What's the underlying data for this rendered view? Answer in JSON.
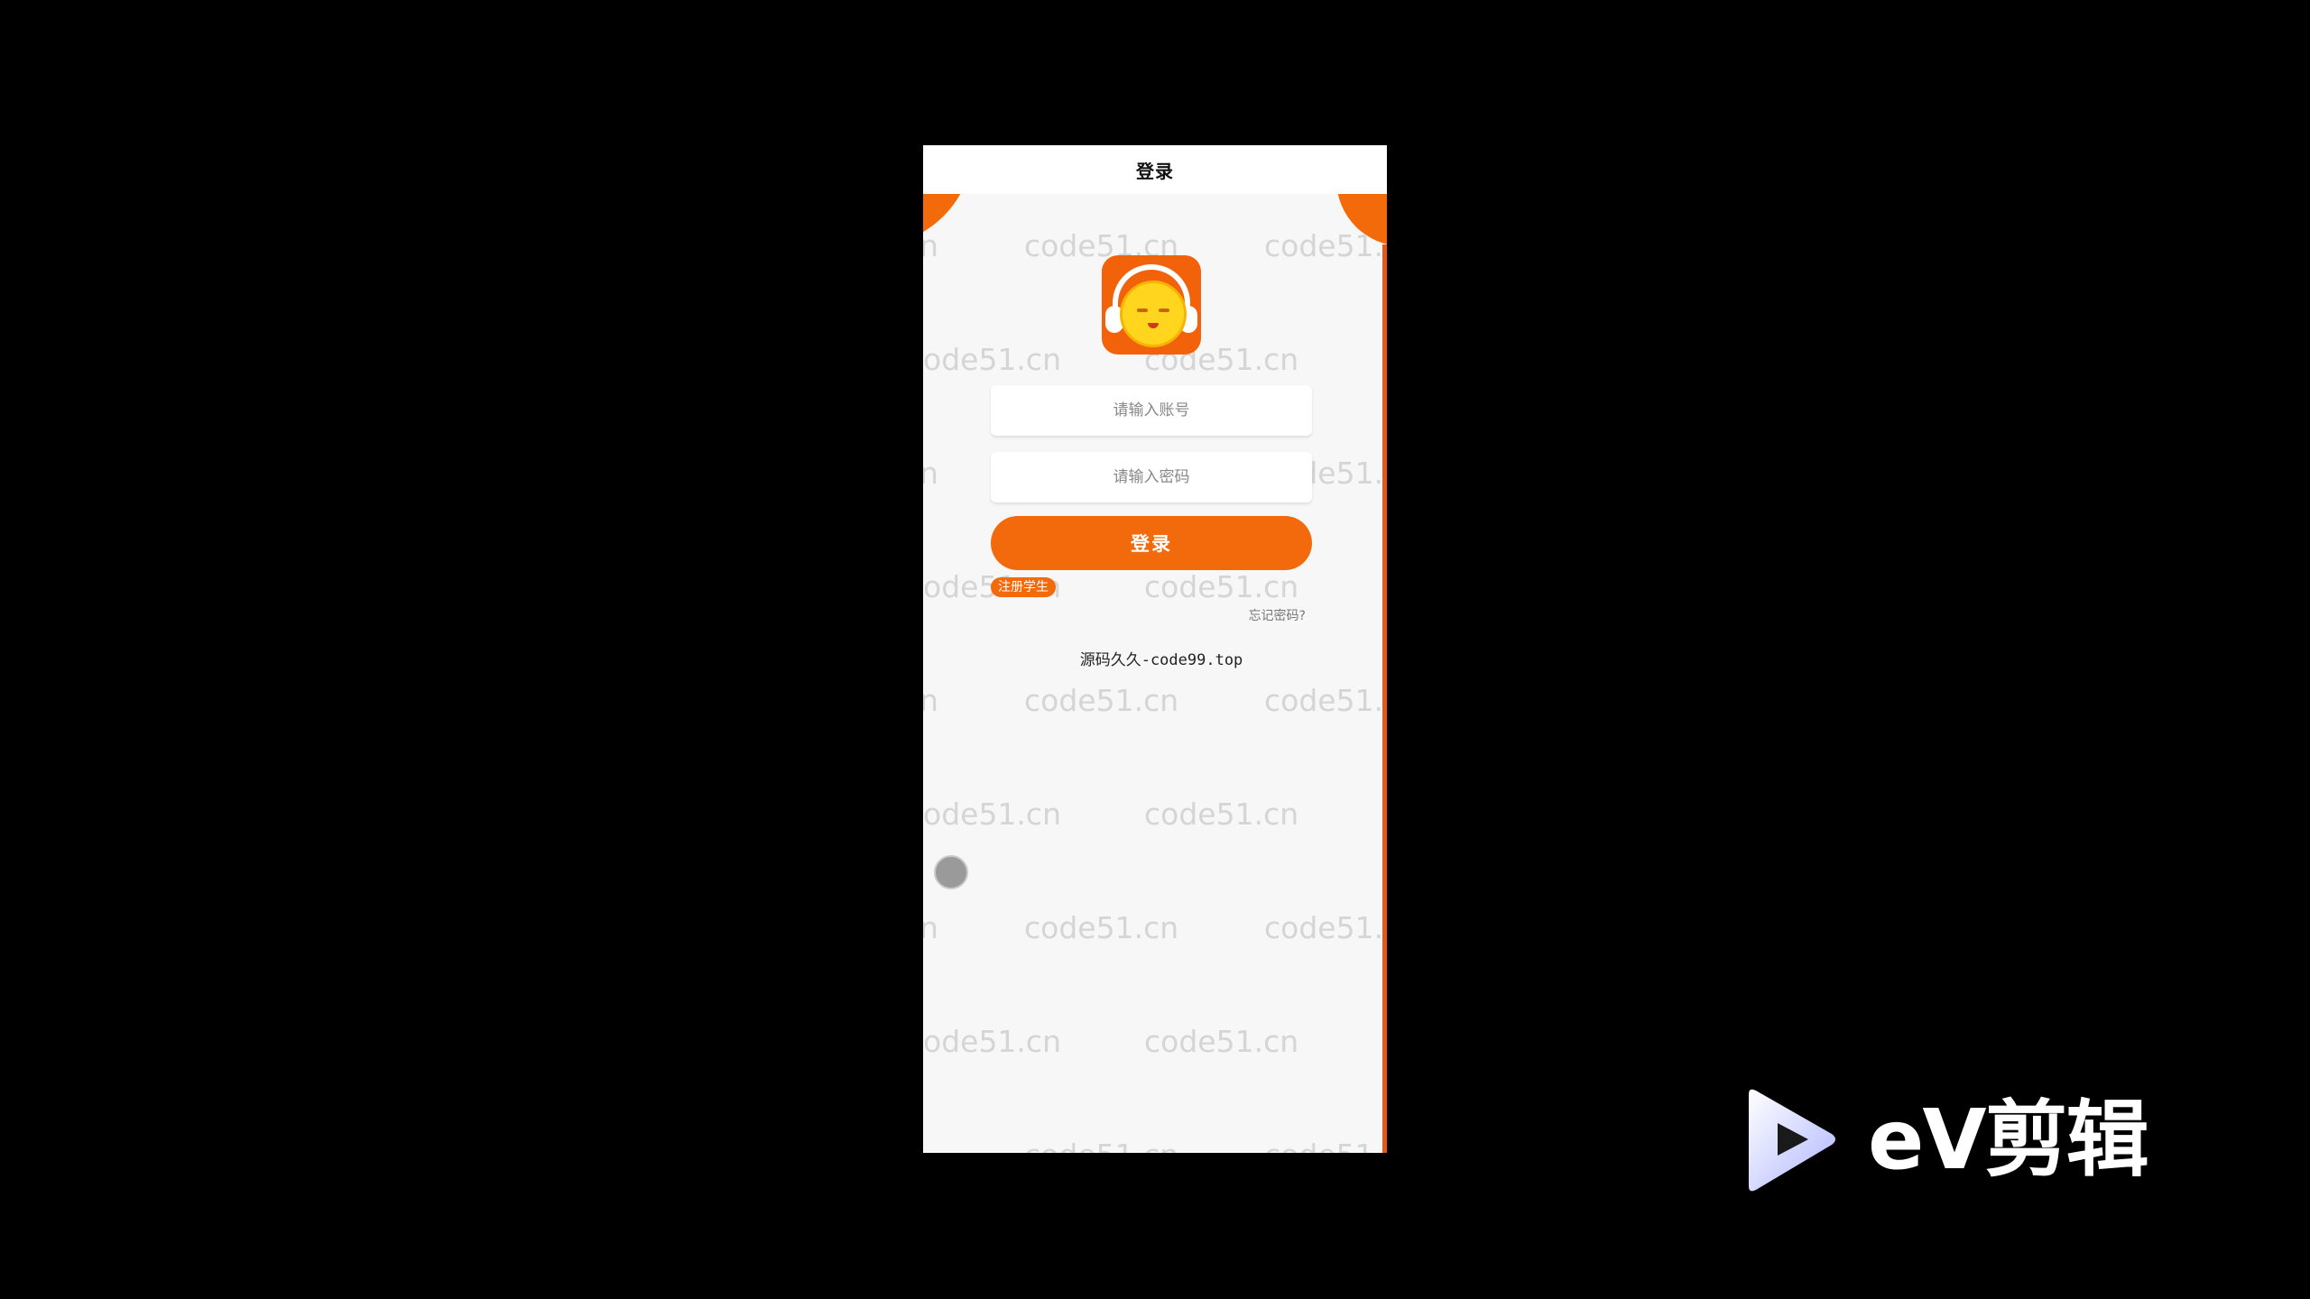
{
  "nav": {
    "title": "登录"
  },
  "watermark": {
    "text": "code51.cn",
    "partial_left": "ode51.cn",
    "partial_edge": "n",
    "partial_right": "code51."
  },
  "form": {
    "account_placeholder": "请输入账号",
    "password_placeholder": "请输入密码",
    "login_label": "登录",
    "register_label": "注册学生",
    "forgot_label": "忘记密码?"
  },
  "footer": {
    "source_text": "源码久久-code99.top"
  },
  "brand": {
    "text": "eV剪辑",
    "icon": "play-triangle-icon"
  },
  "colors": {
    "accent": "#f36a0c",
    "background": "#000000",
    "page": "#f7f7f7"
  }
}
